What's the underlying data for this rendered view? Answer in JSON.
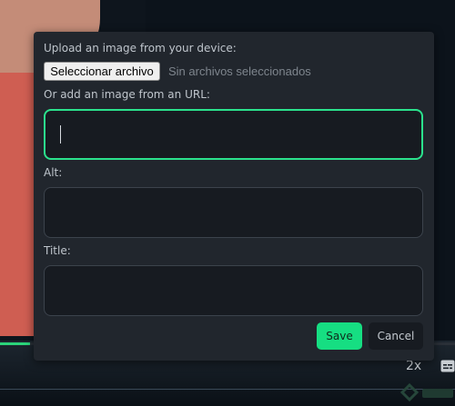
{
  "dialog": {
    "upload_label": "Upload an image from your device:",
    "file_button_label": "Seleccionar archivo",
    "file_status": "Sin archivos seleccionados",
    "url_label": "Or add an image from an URL:",
    "url_value": "",
    "alt_label": "Alt:",
    "alt_value": "",
    "title_label": "Title:",
    "title_value": "",
    "save_label": "Save",
    "cancel_label": "Cancel"
  },
  "player": {
    "speed_label": "2x",
    "progress_fraction": 0.065
  },
  "colors": {
    "accent": "#16de82",
    "focus_border": "#2be28d",
    "dialog_bg": "#21262d",
    "input_bg": "#171b21"
  },
  "icons": [
    "captions-icon",
    "logo-watermark"
  ]
}
